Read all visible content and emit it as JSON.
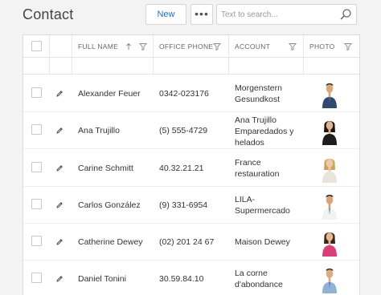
{
  "header": {
    "title": "Contact",
    "new_label": "New",
    "more_label": "•••",
    "search_placeholder": "Text to search..."
  },
  "columns": {
    "full_name": "FULL NAME",
    "office_phone": "OFFICE PHONE",
    "account": "ACCOUNT",
    "photo": "PHOTO"
  },
  "rows": [
    {
      "name": "Alexander Feuer",
      "phone": "0342-023176",
      "account_l1": "Morgenstern",
      "account_l2": "Gesundkost",
      "account_l3": "",
      "photo": "man-portrait",
      "shirt": "#2f4a6e",
      "skin": "#d9a87f",
      "hair": "#3a2a1c"
    },
    {
      "name": "Ana Trujillo",
      "phone": "(5) 555-4729",
      "account_l1": "Ana Trujillo",
      "account_l2": "Emparedados y",
      "account_l3": "helados",
      "photo": "woman-portrait",
      "shirt": "#1d1d1d",
      "skin": "#e1b493",
      "hair": "#1c1410"
    },
    {
      "name": "Carine Schmitt",
      "phone": "40.32.21.21",
      "account_l1": "France",
      "account_l2": "restauration",
      "account_l3": "",
      "photo": "woman-portrait",
      "shirt": "#e9e4da",
      "skin": "#f0c9a8",
      "hair": "#c9a45a"
    },
    {
      "name": "Carlos González",
      "phone": "(9) 331-6954",
      "account_l1": "LILA-",
      "account_l2": "Supermercado",
      "account_l3": "",
      "photo": "man-portrait",
      "shirt": "#f2f2f2",
      "skin": "#d7a47c",
      "hair": "#2a1e16"
    },
    {
      "name": "Catherine Dewey",
      "phone": "(02) 201 24 67",
      "account_l1": "Maison Dewey",
      "account_l2": "",
      "account_l3": "",
      "photo": "woman-portrait",
      "shirt": "#d8407a",
      "skin": "#e6b894",
      "hair": "#3b2418"
    },
    {
      "name": "Daniel Tonini",
      "phone": "30.59.84.10",
      "account_l1": "La corne",
      "account_l2": "d'abondance",
      "account_l3": "",
      "photo": "man-portrait",
      "shirt": "#8fb2d6",
      "skin": "#dcac86",
      "hair": "#3a2a1e"
    }
  ],
  "colors": {
    "accent": "#2a6db5",
    "background": "#f3f3f3",
    "grid_bg": "#ffffff",
    "border": "#dcdcdc"
  }
}
